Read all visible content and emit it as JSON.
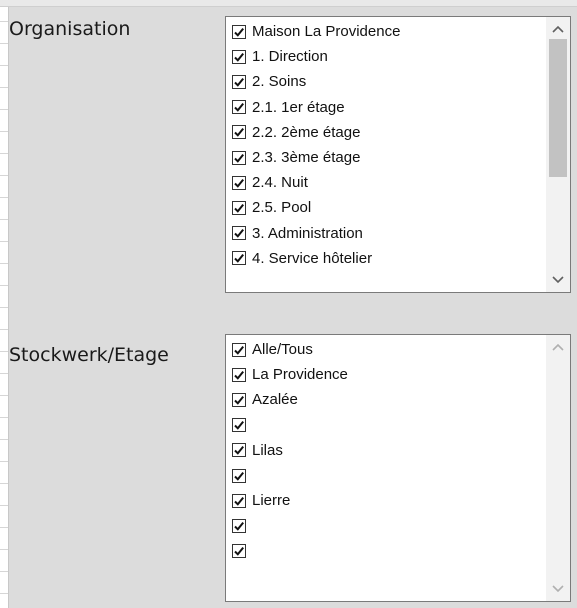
{
  "organisation": {
    "label": "Organisation",
    "items": [
      {
        "label": "Maison La Providence",
        "checked": true
      },
      {
        "label": "1. Direction",
        "checked": true
      },
      {
        "label": "2. Soins",
        "checked": true
      },
      {
        "label": "2.1. 1er étage",
        "checked": true
      },
      {
        "label": "2.2. 2ème étage",
        "checked": true
      },
      {
        "label": "2.3. 3ème étage",
        "checked": true
      },
      {
        "label": "2.4. Nuit",
        "checked": true
      },
      {
        "label": "2.5. Pool",
        "checked": true
      },
      {
        "label": "3. Administration",
        "checked": true
      },
      {
        "label": "4. Service hôtelier",
        "checked": true
      }
    ],
    "scroll_up_icon": "chevron-up-icon",
    "scroll_down_icon": "chevron-down-icon"
  },
  "stockwerk": {
    "label": "Stockwerk/Etage",
    "items": [
      {
        "label": "Alle/Tous",
        "checked": true
      },
      {
        "label": "La Providence",
        "checked": true
      },
      {
        "label": "Azalée",
        "checked": true
      },
      {
        "label": "",
        "checked": true
      },
      {
        "label": "Lilas",
        "checked": true
      },
      {
        "label": "",
        "checked": true
      },
      {
        "label": "Lierre",
        "checked": true
      },
      {
        "label": "",
        "checked": true
      },
      {
        "label": "",
        "checked": true
      }
    ],
    "scroll_up_icon": "chevron-up-icon",
    "scroll_down_icon": "chevron-down-icon"
  },
  "colors": {
    "panel_background": "#dcdcdc",
    "listbox_background": "#ffffff",
    "scroll_thumb": "#c2c2c2"
  }
}
